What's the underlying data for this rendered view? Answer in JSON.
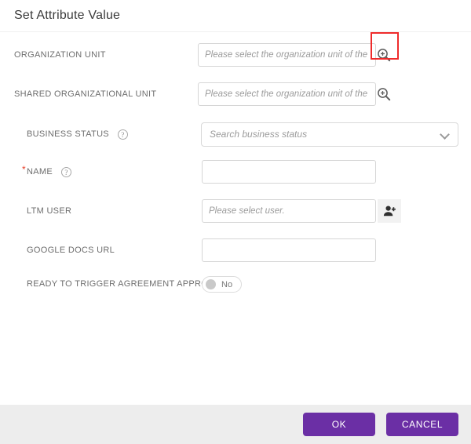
{
  "header": {
    "title": "Set Attribute Value"
  },
  "form": {
    "fields": [
      {
        "label": "ORGANIZATION UNIT",
        "placeholder": "Please select the organization unit of the ag",
        "value": "",
        "icon": "zoom-in-icon",
        "required": false,
        "help": false,
        "highlighted": true
      },
      {
        "label": "SHARED ORGANIZATIONAL UNIT",
        "placeholder": "Please select the organization unit of the ag",
        "value": "",
        "icon": "zoom-in-icon",
        "required": false,
        "help": false,
        "highlighted": false
      },
      {
        "label": "BUSINESS STATUS",
        "placeholder": "Search business status",
        "value": "",
        "icon": "chevron-down-icon",
        "required": false,
        "help": true,
        "highlighted": false
      },
      {
        "label": "NAME",
        "placeholder": "",
        "value": "",
        "icon": "",
        "required": true,
        "help": true,
        "highlighted": false
      },
      {
        "label": "LTM USER",
        "placeholder": "Please select user.",
        "value": "",
        "icon": "add-user-icon",
        "required": false,
        "help": false,
        "highlighted": false
      },
      {
        "label": "GOOGLE DOCS URL",
        "placeholder": "",
        "value": "",
        "icon": "",
        "required": false,
        "help": false,
        "highlighted": false
      },
      {
        "label": "READY TO TRIGGER AGREEMENT APPROVAL",
        "placeholder": "",
        "value": "No",
        "icon": "toggle-off",
        "required": false,
        "help": false,
        "highlighted": false
      }
    ],
    "required_marker": "*",
    "help_glyph": "?"
  },
  "footer": {
    "ok_label": "OK",
    "cancel_label": "CANCEL"
  },
  "colors": {
    "accent": "#6b2fa5",
    "highlight": "#ef2b2b",
    "required": "#e8402a",
    "footer_bg": "#ededed"
  }
}
